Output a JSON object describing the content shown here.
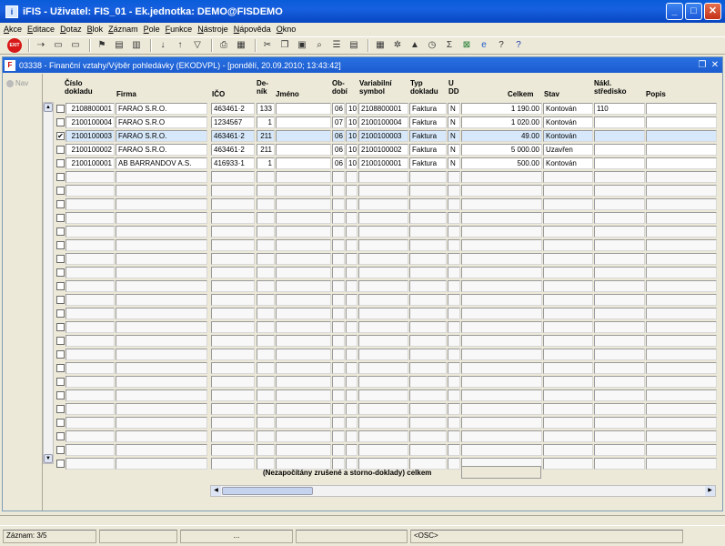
{
  "window": {
    "title": "iFIS - Uživatel: FIS_01 - Ek.jednotka: DEMO@FISDEMO",
    "app_icon": "ifis-icon",
    "controls": [
      "minimize-icon",
      "maximize-icon",
      "close-icon"
    ]
  },
  "menu": [
    "Akce",
    "Editace",
    "Dotaz",
    "Blok",
    "Záznam",
    "Pole",
    "Funkce",
    "Nástroje",
    "Nápověda",
    "Okno"
  ],
  "toolbar": {
    "exit_label": "EXIT",
    "icons": [
      "arrow-in-icon",
      "record-out-icon",
      "record-in-icon",
      "flag-icon",
      "folder-open-icon",
      "folder-delete-icon",
      "sort-az-icon",
      "sort-za-icon",
      "filter-icon",
      "print-icon",
      "print-preview-icon",
      "cut-icon",
      "copy-icon",
      "paste-icon",
      "find-icon",
      "record-list-icon",
      "lov-icon",
      "calc-icon",
      "gear-icon",
      "chart-icon",
      "clock-icon",
      "sigma-icon",
      "excel-icon",
      "ie-icon",
      "help-icon",
      "question-icon"
    ]
  },
  "inner_window": {
    "title": "03338 - Finanční vztahy/Výběr pohledávky (EKODVPL) - [pondělí, 20.09.2010; 13:43:42]",
    "restore": "❐",
    "close": "✕"
  },
  "nav": {
    "label": "Nav"
  },
  "columns": {
    "cislo": "Číslo dokladu",
    "firma": "Firma",
    "ico": "IČO",
    "denik": "De- ník",
    "jmeno": "Jméno",
    "obdobi": "Ob- dobí",
    "vs": "Variabilní symbol",
    "typ": "Typ dokladu",
    "udd": "U DD",
    "celkem": "Celkem",
    "stav": "Stav",
    "nakl": "Nákl. středisko",
    "popis": "Popis"
  },
  "rows": [
    {
      "checked": false,
      "cislo": "2108800001",
      "firma": "FARAO S.R.O.",
      "ico": "463461·2",
      "denik": "133",
      "jmeno": "",
      "ob1": "06",
      "ob2": "10",
      "vs": "2108800001",
      "typ": "Faktura",
      "udd": "N",
      "celkem": "1 190.00",
      "stav": "Kontován",
      "nakl": "110",
      "popis": ""
    },
    {
      "checked": false,
      "cislo": "2100100004",
      "firma": "FARAO S.R.O",
      "ico": "1234567",
      "denik": "1",
      "jmeno": "",
      "ob1": "07",
      "ob2": "10",
      "vs": "2100100004",
      "typ": "Faktura",
      "udd": "N",
      "celkem": "1 020.00",
      "stav": "Kontován",
      "nakl": "",
      "popis": ""
    },
    {
      "checked": true,
      "cislo": "2100100003",
      "firma": "FARAO S.R.O.",
      "ico": "463461·2",
      "denik": "211",
      "jmeno": "",
      "ob1": "06",
      "ob2": "10",
      "vs": "2100100003",
      "typ": "Faktura",
      "udd": "N",
      "celkem": "49.00",
      "stav": "Kontován",
      "nakl": "",
      "popis": ""
    },
    {
      "checked": false,
      "cislo": "2100100002",
      "firma": "FARAO S.R.O.",
      "ico": "463461·2",
      "denik": "211",
      "jmeno": "",
      "ob1": "06",
      "ob2": "10",
      "vs": "2100100002",
      "typ": "Faktura",
      "udd": "N",
      "celkem": "5 000.00",
      "stav": "Uzavřen",
      "nakl": "",
      "popis": ""
    },
    {
      "checked": false,
      "cislo": "2100100001",
      "firma": "AB BARRANDOV A.S.",
      "ico": "416933·1",
      "denik": "1",
      "jmeno": "",
      "ob1": "06",
      "ob2": "10",
      "vs": "2100100001",
      "typ": "Faktura",
      "udd": "N",
      "celkem": "500.00",
      "stav": "Kontován",
      "nakl": "",
      "popis": ""
    }
  ],
  "selected_row_index": 2,
  "total_rows_visible": 27,
  "footer": {
    "label": "(Nezapočítány zrušené a storno-doklady) celkem",
    "value": ""
  },
  "statusbar": {
    "record": "Záznam: 3/5",
    "seg2": "",
    "seg3": "...",
    "seg4": "",
    "osc": "<OSC>"
  },
  "colors": {
    "title_bar": "#0a5cd8",
    "selected_row": "#d6e8fa",
    "window_bg": "#ece9d8"
  }
}
